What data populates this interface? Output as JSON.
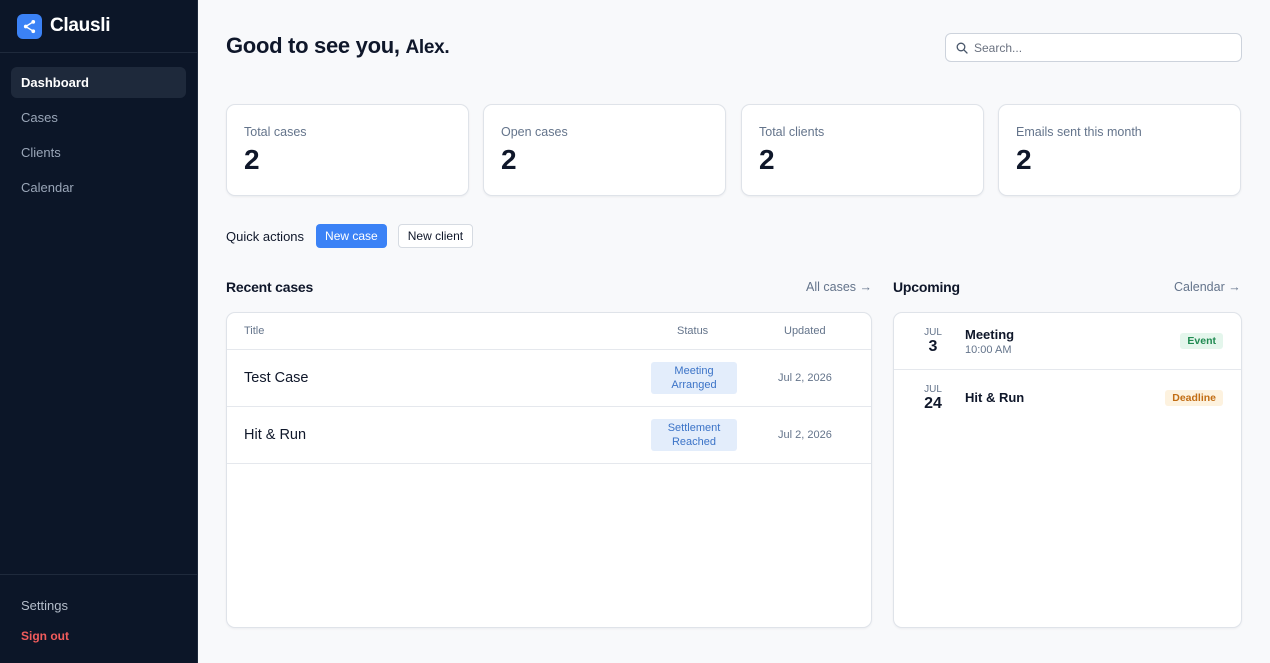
{
  "app": {
    "name": "Clausli"
  },
  "sidebar": {
    "items": [
      {
        "label": "Dashboard",
        "active": true
      },
      {
        "label": "Cases",
        "active": false
      },
      {
        "label": "Clients",
        "active": false
      },
      {
        "label": "Calendar",
        "active": false
      }
    ],
    "settings": "Settings",
    "sign_out": "Sign out"
  },
  "header": {
    "greeting": "Good to see you,",
    "user_name": "Alex.",
    "search_placeholder": "Search..."
  },
  "stats": [
    {
      "label": "Total cases",
      "value": "2"
    },
    {
      "label": "Open cases",
      "value": "2"
    },
    {
      "label": "Total clients",
      "value": "2"
    },
    {
      "label": "Emails sent this month",
      "value": "2"
    }
  ],
  "quick_actions": {
    "label": "Quick actions",
    "new_case": "New case",
    "new_client": "New client"
  },
  "recent_cases": {
    "title": "Recent cases",
    "link": "All cases →",
    "columns": {
      "title": "Title",
      "status": "Status",
      "updated": "Updated"
    },
    "rows": [
      {
        "title": "Test Case",
        "status_line1": "Meeting",
        "status_line2": "Arranged",
        "updated": "Jul 2, 2026"
      },
      {
        "title": "Hit & Run",
        "status_line1": "Settlement",
        "status_line2": "Reached",
        "updated": "Jul 2, 2026"
      }
    ]
  },
  "upcoming": {
    "title": "Upcoming",
    "link": "Calendar →",
    "events": [
      {
        "month": "JUL",
        "day": "3",
        "title": "Meeting",
        "time": "10:00 AM",
        "badge": "Event",
        "badge_color": "#1f8a51"
      },
      {
        "month": "JUL",
        "day": "24",
        "title": "Hit & Run",
        "time": "",
        "badge": "Deadline",
        "badge_color": "#c26d14"
      }
    ]
  },
  "colors": {
    "sidebar_bg": "#0c1628",
    "accent": "#3b82f6",
    "sign_out": "#f25c5c"
  }
}
